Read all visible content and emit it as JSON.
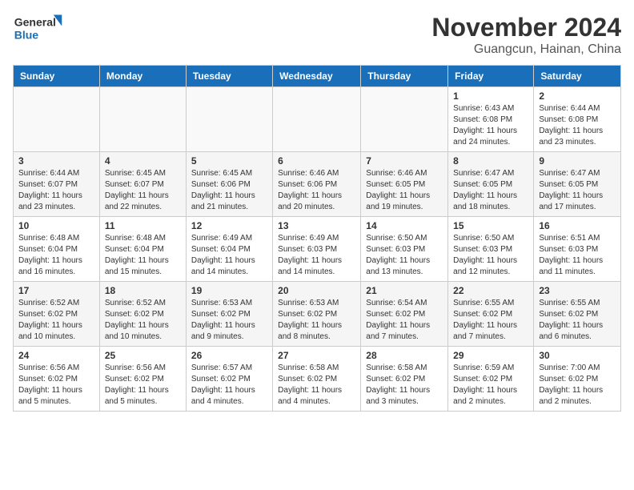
{
  "logo": {
    "line1": "General",
    "line2": "Blue"
  },
  "title": "November 2024",
  "location": "Guangcun, Hainan, China",
  "weekdays": [
    "Sunday",
    "Monday",
    "Tuesday",
    "Wednesday",
    "Thursday",
    "Friday",
    "Saturday"
  ],
  "weeks": [
    [
      {
        "day": "",
        "info": ""
      },
      {
        "day": "",
        "info": ""
      },
      {
        "day": "",
        "info": ""
      },
      {
        "day": "",
        "info": ""
      },
      {
        "day": "",
        "info": ""
      },
      {
        "day": "1",
        "info": "Sunrise: 6:43 AM\nSunset: 6:08 PM\nDaylight: 11 hours and 24 minutes."
      },
      {
        "day": "2",
        "info": "Sunrise: 6:44 AM\nSunset: 6:08 PM\nDaylight: 11 hours and 23 minutes."
      }
    ],
    [
      {
        "day": "3",
        "info": "Sunrise: 6:44 AM\nSunset: 6:07 PM\nDaylight: 11 hours and 23 minutes."
      },
      {
        "day": "4",
        "info": "Sunrise: 6:45 AM\nSunset: 6:07 PM\nDaylight: 11 hours and 22 minutes."
      },
      {
        "day": "5",
        "info": "Sunrise: 6:45 AM\nSunset: 6:06 PM\nDaylight: 11 hours and 21 minutes."
      },
      {
        "day": "6",
        "info": "Sunrise: 6:46 AM\nSunset: 6:06 PM\nDaylight: 11 hours and 20 minutes."
      },
      {
        "day": "7",
        "info": "Sunrise: 6:46 AM\nSunset: 6:05 PM\nDaylight: 11 hours and 19 minutes."
      },
      {
        "day": "8",
        "info": "Sunrise: 6:47 AM\nSunset: 6:05 PM\nDaylight: 11 hours and 18 minutes."
      },
      {
        "day": "9",
        "info": "Sunrise: 6:47 AM\nSunset: 6:05 PM\nDaylight: 11 hours and 17 minutes."
      }
    ],
    [
      {
        "day": "10",
        "info": "Sunrise: 6:48 AM\nSunset: 6:04 PM\nDaylight: 11 hours and 16 minutes."
      },
      {
        "day": "11",
        "info": "Sunrise: 6:48 AM\nSunset: 6:04 PM\nDaylight: 11 hours and 15 minutes."
      },
      {
        "day": "12",
        "info": "Sunrise: 6:49 AM\nSunset: 6:04 PM\nDaylight: 11 hours and 14 minutes."
      },
      {
        "day": "13",
        "info": "Sunrise: 6:49 AM\nSunset: 6:03 PM\nDaylight: 11 hours and 14 minutes."
      },
      {
        "day": "14",
        "info": "Sunrise: 6:50 AM\nSunset: 6:03 PM\nDaylight: 11 hours and 13 minutes."
      },
      {
        "day": "15",
        "info": "Sunrise: 6:50 AM\nSunset: 6:03 PM\nDaylight: 11 hours and 12 minutes."
      },
      {
        "day": "16",
        "info": "Sunrise: 6:51 AM\nSunset: 6:03 PM\nDaylight: 11 hours and 11 minutes."
      }
    ],
    [
      {
        "day": "17",
        "info": "Sunrise: 6:52 AM\nSunset: 6:02 PM\nDaylight: 11 hours and 10 minutes."
      },
      {
        "day": "18",
        "info": "Sunrise: 6:52 AM\nSunset: 6:02 PM\nDaylight: 11 hours and 10 minutes."
      },
      {
        "day": "19",
        "info": "Sunrise: 6:53 AM\nSunset: 6:02 PM\nDaylight: 11 hours and 9 minutes."
      },
      {
        "day": "20",
        "info": "Sunrise: 6:53 AM\nSunset: 6:02 PM\nDaylight: 11 hours and 8 minutes."
      },
      {
        "day": "21",
        "info": "Sunrise: 6:54 AM\nSunset: 6:02 PM\nDaylight: 11 hours and 7 minutes."
      },
      {
        "day": "22",
        "info": "Sunrise: 6:55 AM\nSunset: 6:02 PM\nDaylight: 11 hours and 7 minutes."
      },
      {
        "day": "23",
        "info": "Sunrise: 6:55 AM\nSunset: 6:02 PM\nDaylight: 11 hours and 6 minutes."
      }
    ],
    [
      {
        "day": "24",
        "info": "Sunrise: 6:56 AM\nSunset: 6:02 PM\nDaylight: 11 hours and 5 minutes."
      },
      {
        "day": "25",
        "info": "Sunrise: 6:56 AM\nSunset: 6:02 PM\nDaylight: 11 hours and 5 minutes."
      },
      {
        "day": "26",
        "info": "Sunrise: 6:57 AM\nSunset: 6:02 PM\nDaylight: 11 hours and 4 minutes."
      },
      {
        "day": "27",
        "info": "Sunrise: 6:58 AM\nSunset: 6:02 PM\nDaylight: 11 hours and 4 minutes."
      },
      {
        "day": "28",
        "info": "Sunrise: 6:58 AM\nSunset: 6:02 PM\nDaylight: 11 hours and 3 minutes."
      },
      {
        "day": "29",
        "info": "Sunrise: 6:59 AM\nSunset: 6:02 PM\nDaylight: 11 hours and 2 minutes."
      },
      {
        "day": "30",
        "info": "Sunrise: 7:00 AM\nSunset: 6:02 PM\nDaylight: 11 hours and 2 minutes."
      }
    ]
  ]
}
